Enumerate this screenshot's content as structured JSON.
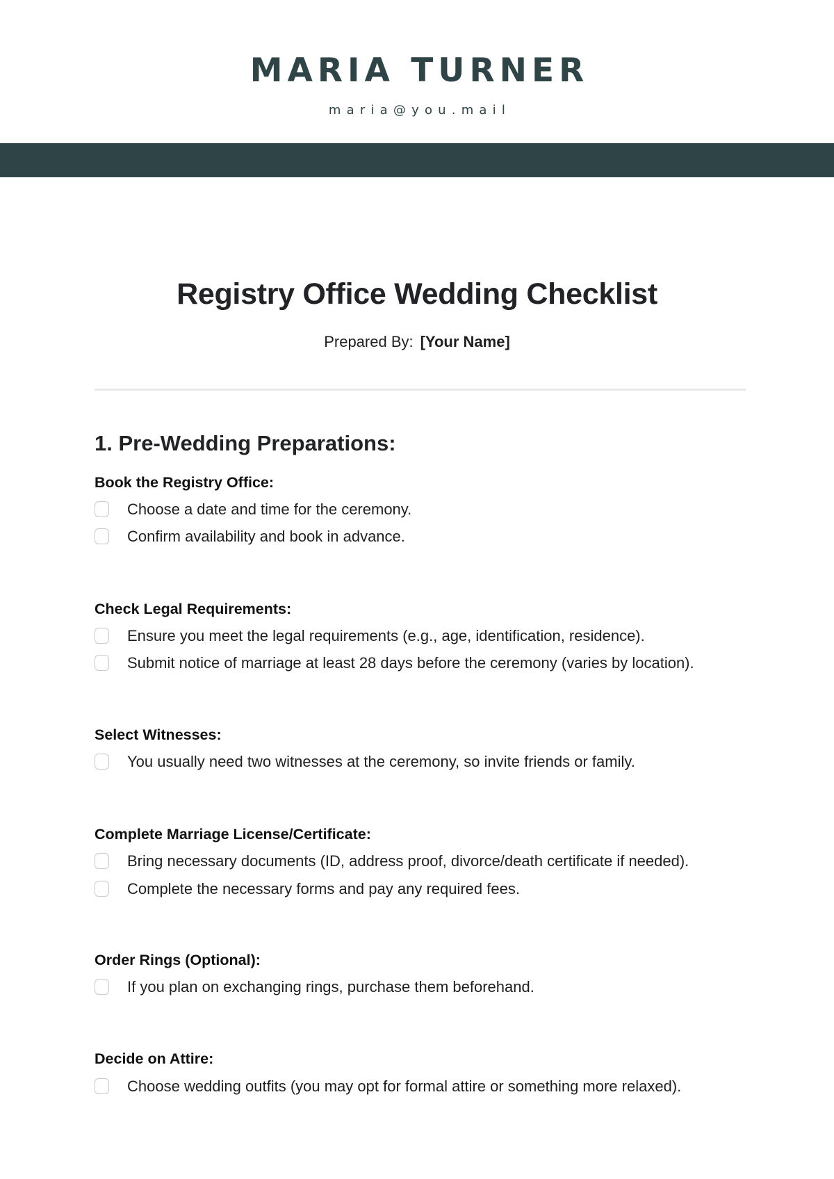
{
  "header": {
    "name": "MARIA TURNER",
    "email": "maria@you.mail",
    "band_color": "#2f4447"
  },
  "document": {
    "title": "Registry Office Wedding Checklist",
    "prepared_by_label": "Prepared By:",
    "prepared_by_value": "[Your Name]"
  },
  "sections": [
    {
      "heading": "1. Pre-Wedding Preparations:",
      "groups": [
        {
          "heading": "Book the Registry Office:",
          "items": [
            {
              "text": "Choose a date and time for the ceremony.",
              "checked": false
            },
            {
              "text": "Confirm availability and book in advance.",
              "checked": false
            }
          ]
        },
        {
          "heading": "Check Legal Requirements:",
          "items": [
            {
              "text": "Ensure you meet the legal requirements (e.g., age, identification, residence).",
              "checked": false
            },
            {
              "text": "Submit notice of marriage at least 28 days before the ceremony (varies by location).",
              "checked": false
            }
          ]
        },
        {
          "heading": "Select Witnesses:",
          "items": [
            {
              "text": "You usually need two witnesses at the ceremony, so invite friends or family.",
              "checked": false
            }
          ]
        },
        {
          "heading": "Complete Marriage License/Certificate:",
          "items": [
            {
              "text": "Bring necessary documents (ID, address proof, divorce/death certificate if needed).",
              "checked": false
            },
            {
              "text": "Complete the necessary forms and pay any required fees.",
              "checked": false
            }
          ]
        },
        {
          "heading": "Order Rings (Optional):",
          "items": [
            {
              "text": "If you plan on exchanging rings, purchase them beforehand.",
              "checked": false
            }
          ]
        },
        {
          "heading": "Decide on Attire:",
          "items": [
            {
              "text": "Choose wedding outfits (you may opt for formal attire or something more relaxed).",
              "checked": false
            }
          ]
        }
      ]
    }
  ]
}
